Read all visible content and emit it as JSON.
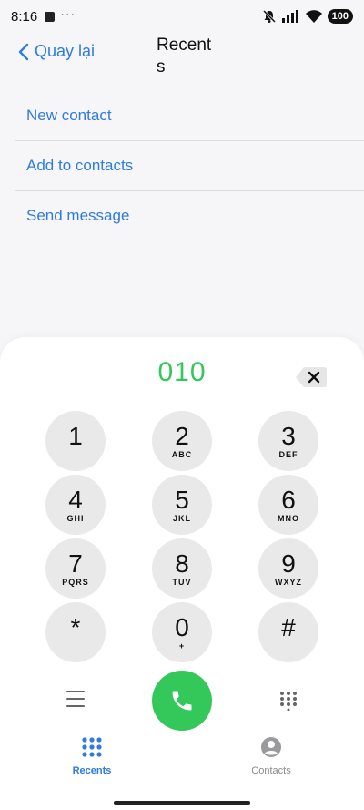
{
  "status": {
    "time": "8:16",
    "dots": "···",
    "battery": "100"
  },
  "header": {
    "back_label": "Quay lại",
    "title": "Recents"
  },
  "menu": {
    "items": [
      {
        "label": "New contact"
      },
      {
        "label": "Add to contacts"
      },
      {
        "label": "Send message"
      }
    ]
  },
  "dialer": {
    "number": "010",
    "keys": [
      {
        "digit": "1",
        "letters": ""
      },
      {
        "digit": "2",
        "letters": "ABC"
      },
      {
        "digit": "3",
        "letters": "DEF"
      },
      {
        "digit": "4",
        "letters": "GHI"
      },
      {
        "digit": "5",
        "letters": "JKL"
      },
      {
        "digit": "6",
        "letters": "MNO"
      },
      {
        "digit": "7",
        "letters": "PQRS"
      },
      {
        "digit": "8",
        "letters": "TUV"
      },
      {
        "digit": "9",
        "letters": "WXYZ"
      },
      {
        "digit": "*",
        "letters": ""
      },
      {
        "digit": "0",
        "letters": "+"
      },
      {
        "digit": "#",
        "letters": ""
      }
    ],
    "call_color": "#34c759"
  },
  "tabs": [
    {
      "label": "Recents",
      "icon": "keypad-icon",
      "active": true
    },
    {
      "label": "Contacts",
      "icon": "person-icon",
      "active": false
    }
  ],
  "colors": {
    "accent": "#2f7be0",
    "green": "#34c759"
  }
}
